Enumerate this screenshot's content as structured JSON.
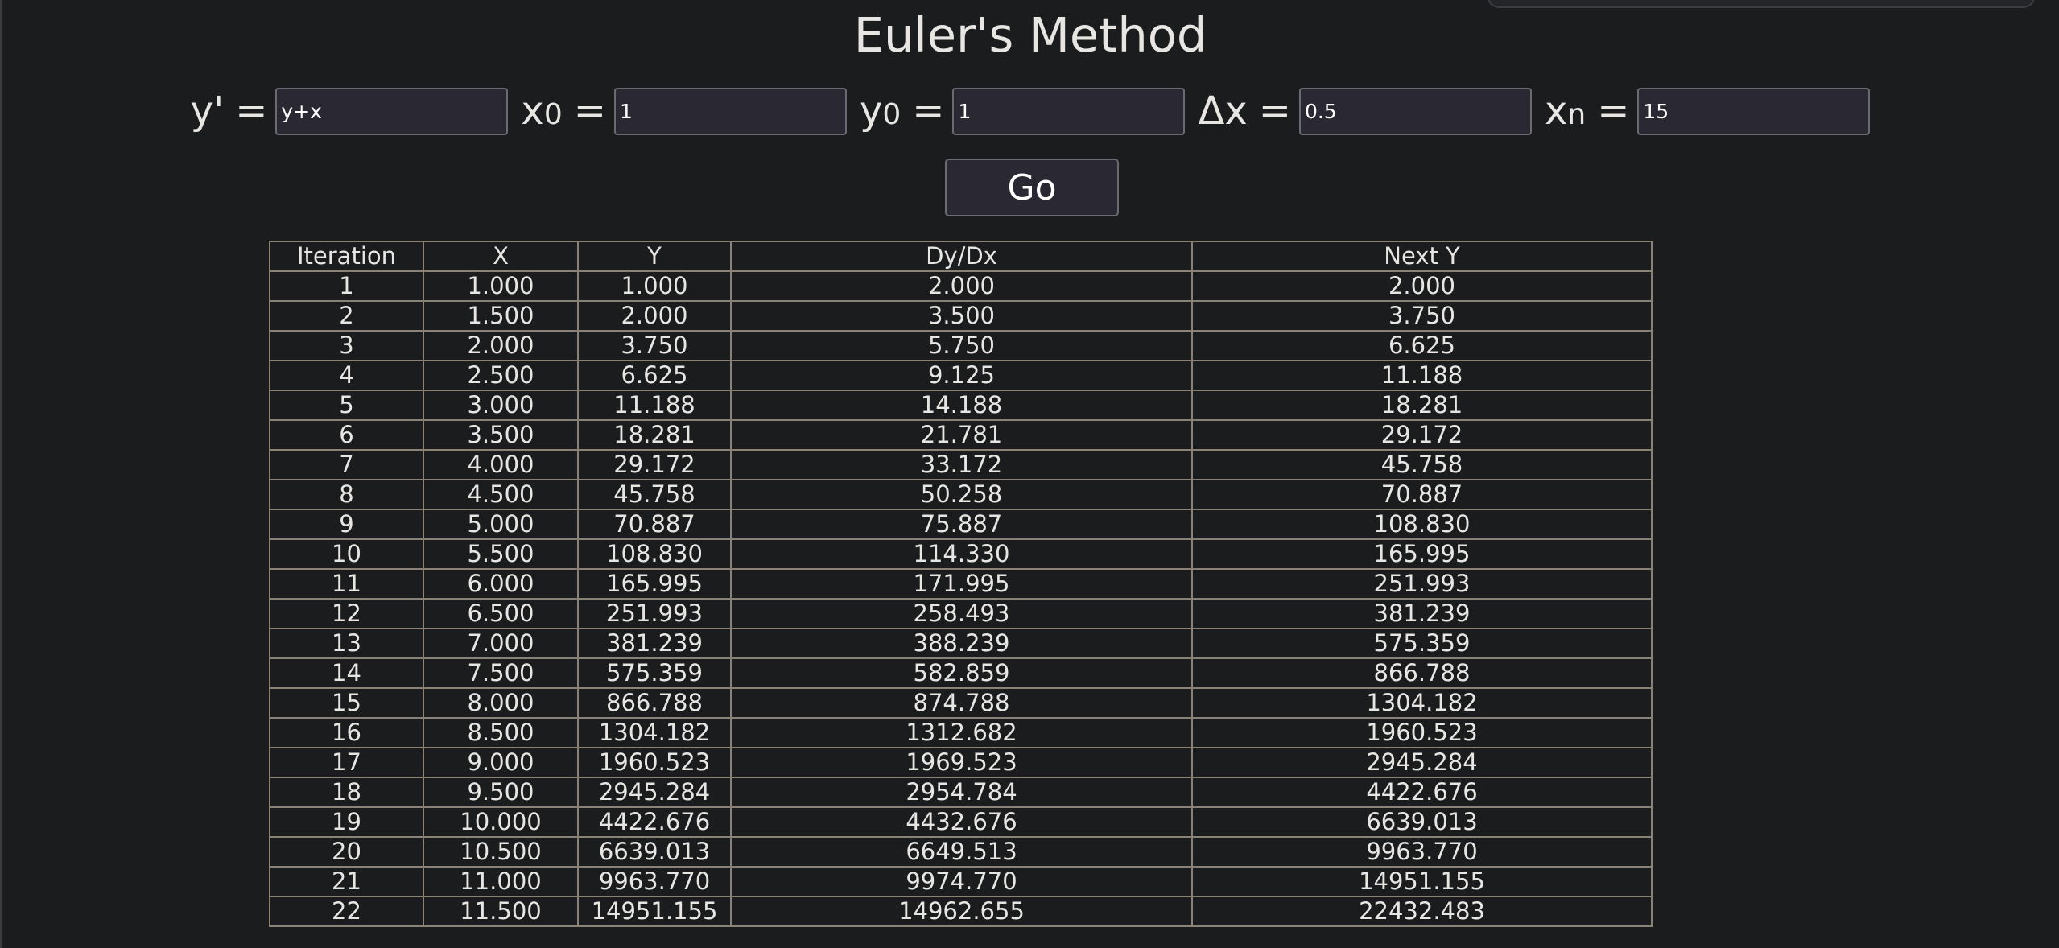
{
  "title": "Euler's Method",
  "params": [
    {
      "id": "derivative",
      "label": "y'",
      "sub": "",
      "value": "y+x"
    },
    {
      "id": "x0",
      "label": "x",
      "sub": "0",
      "value": "1"
    },
    {
      "id": "y0",
      "label": "y",
      "sub": "0",
      "value": "1"
    },
    {
      "id": "dx",
      "label": "Δx",
      "sub": "",
      "value": "0.5"
    },
    {
      "id": "xn",
      "label": "x",
      "sub": "n",
      "value": "15"
    }
  ],
  "equals": "=",
  "go_label": "Go",
  "table": {
    "columns": [
      "Iteration",
      "X",
      "Y",
      "Dy/Dx",
      "Next Y"
    ],
    "rows": [
      [
        "1",
        "1.000",
        "1.000",
        "2.000",
        "2.000"
      ],
      [
        "2",
        "1.500",
        "2.000",
        "3.500",
        "3.750"
      ],
      [
        "3",
        "2.000",
        "3.750",
        "5.750",
        "6.625"
      ],
      [
        "4",
        "2.500",
        "6.625",
        "9.125",
        "11.188"
      ],
      [
        "5",
        "3.000",
        "11.188",
        "14.188",
        "18.281"
      ],
      [
        "6",
        "3.500",
        "18.281",
        "21.781",
        "29.172"
      ],
      [
        "7",
        "4.000",
        "29.172",
        "33.172",
        "45.758"
      ],
      [
        "8",
        "4.500",
        "45.758",
        "50.258",
        "70.887"
      ],
      [
        "9",
        "5.000",
        "70.887",
        "75.887",
        "108.830"
      ],
      [
        "10",
        "5.500",
        "108.830",
        "114.330",
        "165.995"
      ],
      [
        "11",
        "6.000",
        "165.995",
        "171.995",
        "251.993"
      ],
      [
        "12",
        "6.500",
        "251.993",
        "258.493",
        "381.239"
      ],
      [
        "13",
        "7.000",
        "381.239",
        "388.239",
        "575.359"
      ],
      [
        "14",
        "7.500",
        "575.359",
        "582.859",
        "866.788"
      ],
      [
        "15",
        "8.000",
        "866.788",
        "874.788",
        "1304.182"
      ],
      [
        "16",
        "8.500",
        "1304.182",
        "1312.682",
        "1960.523"
      ],
      [
        "17",
        "9.000",
        "1960.523",
        "1969.523",
        "2945.284"
      ],
      [
        "18",
        "9.500",
        "2945.284",
        "2954.784",
        "4422.676"
      ],
      [
        "19",
        "10.000",
        "4422.676",
        "4432.676",
        "6639.013"
      ],
      [
        "20",
        "10.500",
        "6639.013",
        "6649.513",
        "9963.770"
      ],
      [
        "21",
        "11.000",
        "9963.770",
        "9974.770",
        "14951.155"
      ],
      [
        "22",
        "11.500",
        "14951.155",
        "14962.655",
        "22432.483"
      ]
    ]
  }
}
